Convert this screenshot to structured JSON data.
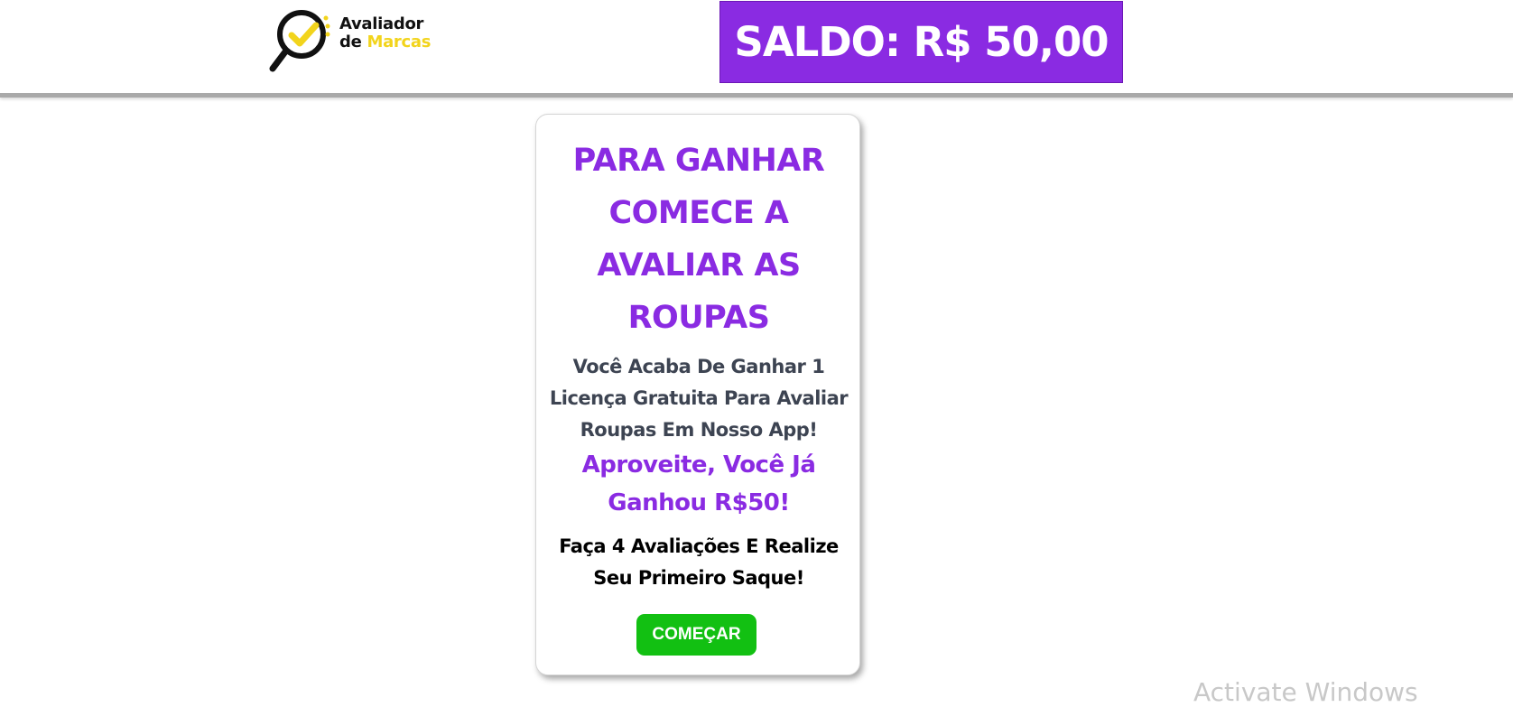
{
  "header": {
    "logo": {
      "line1": "Avaliador",
      "line2_prefix": "de",
      "line2_accent": "Marcas",
      "accent_color": "#f2d41c",
      "icon": "magnifier-check-icon"
    },
    "balance_label": "SALDO: R$ 50,00",
    "balance_bg": "#8a2be2"
  },
  "card": {
    "title": "PARA GANHAR COMECE A AVALIAR AS ROUPAS",
    "subtitle": "Você Acaba De Ganhar 1 Licença Gratuita Para Avaliar Roupas Em Nosso App!",
    "highlight": "Aproveite, Você Já Ganhou R$50!",
    "goal": "Faça 4 Avaliações E Realize Seu Primeiro Saque!",
    "button_label": "COMEÇAR",
    "button_color": "#12c012",
    "title_color": "#8a2be2"
  },
  "watermark": "Activate Windows"
}
